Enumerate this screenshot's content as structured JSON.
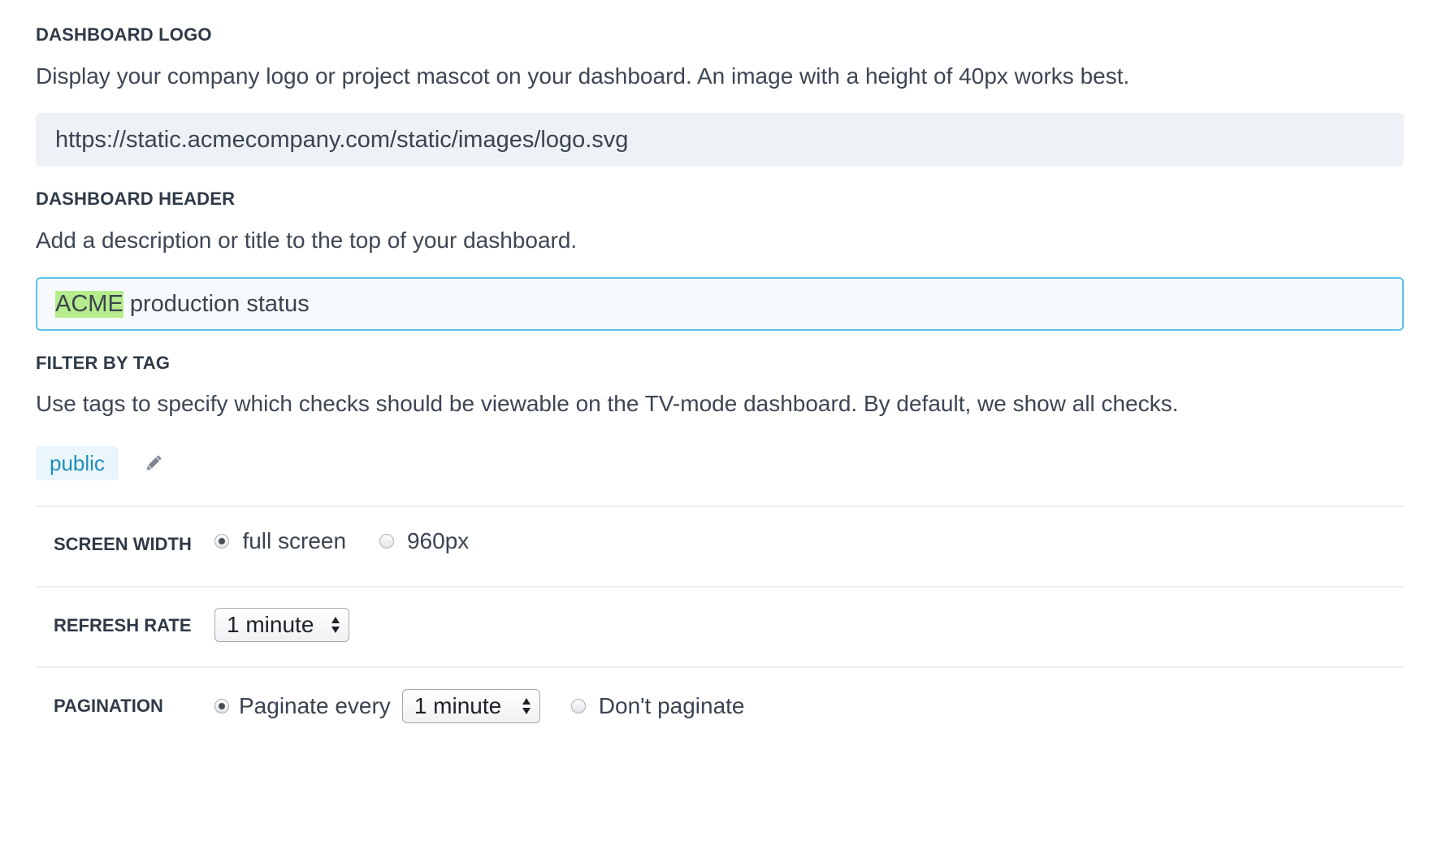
{
  "logo": {
    "label": "DASHBOARD LOGO",
    "description": "Display your company logo or project mascot on your dashboard. An image with a height of 40px works best.",
    "value": "https://static.acmecompany.com/static/images/logo.svg"
  },
  "header": {
    "label": "DASHBOARD HEADER",
    "description": "Add a description or title to the top of your dashboard.",
    "value_highlight": "ACME",
    "value_rest": " production status"
  },
  "filter": {
    "label": "FILTER BY TAG",
    "description": "Use tags to specify which checks should be viewable on the TV-mode dashboard. By default, we show all checks.",
    "tags": [
      "public"
    ],
    "edit_icon": "pencil-icon"
  },
  "screen_width": {
    "label": "SCREEN WIDTH",
    "options": [
      "full screen",
      "960px"
    ],
    "selected": "full screen"
  },
  "refresh_rate": {
    "label": "REFRESH RATE",
    "value": "1 minute"
  },
  "pagination": {
    "label": "PAGINATION",
    "option_paginate": "Paginate every",
    "interval": "1 minute",
    "option_no_paginate": "Don't paginate",
    "selected": "Paginate every"
  },
  "colors": {
    "focus_border": "#5bc1ea",
    "highlight": "#b6ec8b",
    "tag_text": "#1f8fb8",
    "tag_bg": "#eaf6fb"
  }
}
